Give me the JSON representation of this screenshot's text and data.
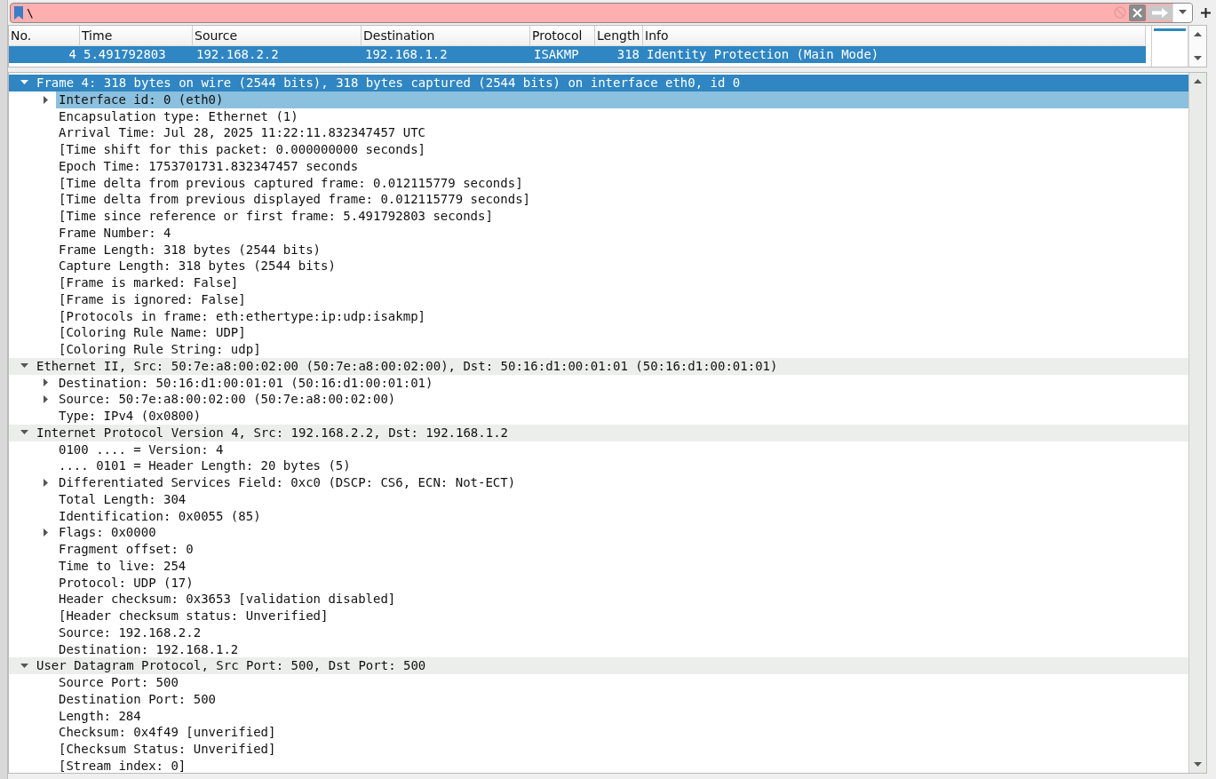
{
  "filter": {
    "value": "\\"
  },
  "packet_list": {
    "columns": [
      "No.",
      "Time",
      "Source",
      "Destination",
      "Protocol",
      "Length",
      "Info"
    ],
    "rows": [
      {
        "selected": true,
        "cells": [
          "4",
          "5.491792803",
          "192.168.2.2",
          "192.168.1.2",
          "ISAKMP",
          "318",
          "Identity Protection (Main Mode)"
        ]
      }
    ]
  },
  "details": [
    {
      "label": "Frame 4: 318 bytes on wire (2544 bits), 318 bytes captured (2544 bits) on interface eth0, id 0",
      "selected": true,
      "expanded": true,
      "children": [
        {
          "label": "Interface id: 0 (eth0)",
          "expanded": false,
          "highlighted": true
        },
        {
          "label": "Encapsulation type: Ethernet (1)"
        },
        {
          "label": "Arrival Time: Jul 28, 2025 11:22:11.832347457 UTC"
        },
        {
          "label": "[Time shift for this packet: 0.000000000 seconds]"
        },
        {
          "label": "Epoch Time: 1753701731.832347457 seconds"
        },
        {
          "label": "[Time delta from previous captured frame: 0.012115779 seconds]"
        },
        {
          "label": "[Time delta from previous displayed frame: 0.012115779 seconds]"
        },
        {
          "label": "[Time since reference or first frame: 5.491792803 seconds]"
        },
        {
          "label": "Frame Number: 4"
        },
        {
          "label": "Frame Length: 318 bytes (2544 bits)"
        },
        {
          "label": "Capture Length: 318 bytes (2544 bits)"
        },
        {
          "label": "[Frame is marked: False]"
        },
        {
          "label": "[Frame is ignored: False]"
        },
        {
          "label": "[Protocols in frame: eth:ethertype:ip:udp:isakmp]"
        },
        {
          "label": "[Coloring Rule Name: UDP]"
        },
        {
          "label": "[Coloring Rule String: udp]"
        }
      ]
    },
    {
      "label": "Ethernet II, Src: 50:7e:a8:00:02:00 (50:7e:a8:00:02:00), Dst: 50:16:d1:00:01:01 (50:16:d1:00:01:01)",
      "selected": false,
      "expanded": true,
      "children": [
        {
          "label": "Destination: 50:16:d1:00:01:01 (50:16:d1:00:01:01)",
          "expanded": false
        },
        {
          "label": "Source: 50:7e:a8:00:02:00 (50:7e:a8:00:02:00)",
          "expanded": false
        },
        {
          "label": "Type: IPv4 (0x0800)"
        }
      ]
    },
    {
      "label": "Internet Protocol Version 4, Src: 192.168.2.2, Dst: 192.168.1.2",
      "selected": false,
      "expanded": true,
      "children": [
        {
          "label": "0100 .... = Version: 4"
        },
        {
          "label": ".... 0101 = Header Length: 20 bytes (5)"
        },
        {
          "label": "Differentiated Services Field: 0xc0 (DSCP: CS6, ECN: Not-ECT)",
          "expanded": false
        },
        {
          "label": "Total Length: 304"
        },
        {
          "label": "Identification: 0x0055 (85)"
        },
        {
          "label": "Flags: 0x0000",
          "expanded": false
        },
        {
          "label": "Fragment offset: 0"
        },
        {
          "label": "Time to live: 254"
        },
        {
          "label": "Protocol: UDP (17)"
        },
        {
          "label": "Header checksum: 0x3653 [validation disabled]"
        },
        {
          "label": "[Header checksum status: Unverified]"
        },
        {
          "label": "Source: 192.168.2.2"
        },
        {
          "label": "Destination: 192.168.1.2"
        }
      ]
    },
    {
      "label": "User Datagram Protocol, Src Port: 500, Dst Port: 500",
      "selected": false,
      "expanded": true,
      "children": [
        {
          "label": "Source Port: 500"
        },
        {
          "label": "Destination Port: 500"
        },
        {
          "label": "Length: 284"
        },
        {
          "label": "Checksum: 0x4f49 [unverified]"
        },
        {
          "label": "[Checksum Status: Unverified]"
        },
        {
          "label": "[Stream index: 0]"
        }
      ]
    }
  ]
}
